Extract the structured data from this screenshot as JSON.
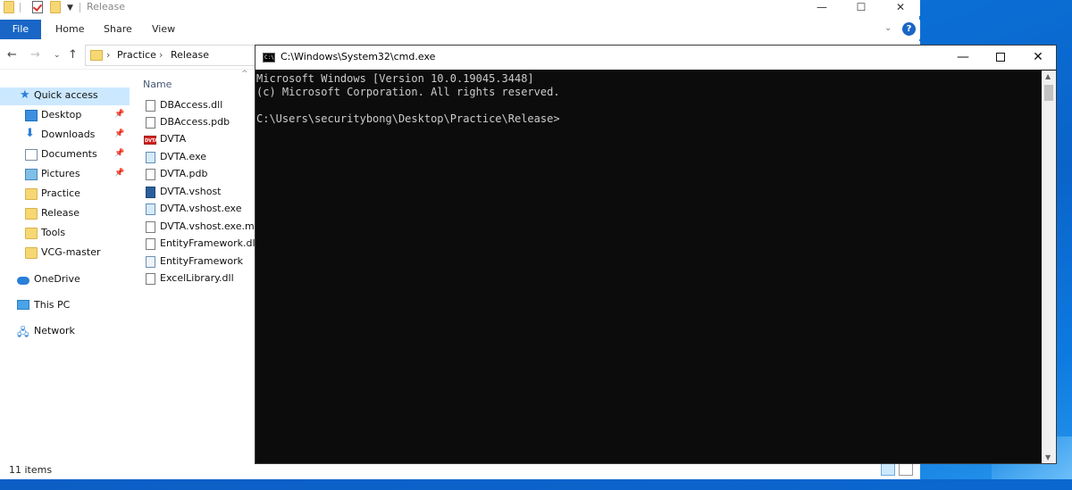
{
  "explorer": {
    "window_title": "Release",
    "ribbon_tabs": {
      "file": "File",
      "home": "Home",
      "share": "Share",
      "view": "View"
    },
    "breadcrumb": [
      "Practice",
      "Release"
    ],
    "nav_header": "Name",
    "nav": {
      "quick_access": "Quick access",
      "pinned": [
        "Desktop",
        "Downloads",
        "Documents",
        "Pictures"
      ],
      "folders": [
        "Practice",
        "Release",
        "Tools",
        "VCG-master"
      ],
      "onedrive": "OneDrive",
      "this_pc": "This PC",
      "network": "Network"
    },
    "files": [
      {
        "name": "DBAccess.dll",
        "icon": "dll-file-icon"
      },
      {
        "name": "DBAccess.pdb",
        "icon": "pdb-file-icon"
      },
      {
        "name": "DVTA",
        "icon": "dvta-app-icon"
      },
      {
        "name": "DVTA.exe",
        "icon": "exe-file-icon"
      },
      {
        "name": "DVTA.pdb",
        "icon": "pdb-file-icon"
      },
      {
        "name": "DVTA.vshost",
        "icon": "vshost-app-icon"
      },
      {
        "name": "DVTA.vshost.exe",
        "icon": "exe-file-icon"
      },
      {
        "name": "DVTA.vshost.exe.mani",
        "icon": "manifest-file-icon"
      },
      {
        "name": "EntityFramework.dll",
        "icon": "dll-file-icon"
      },
      {
        "name": "EntityFramework",
        "icon": "xml-file-icon"
      },
      {
        "name": "ExcelLibrary.dll",
        "icon": "dll-file-icon"
      }
    ],
    "status": "11 items"
  },
  "cmd": {
    "title": "C:\\Windows\\System32\\cmd.exe",
    "icon_text": "C:\\.",
    "lines": [
      "Microsoft Windows [Version 10.0.19045.3448]",
      "(c) Microsoft Corporation. All rights reserved.",
      "",
      "C:\\Users\\securitybong\\Desktop\\Practice\\Release>"
    ]
  },
  "colors": {
    "file_tab": "#1966c6",
    "selection": "#cce8ff",
    "console_bg": "#0c0c0c",
    "console_text": "#cccccc",
    "desktop": "#0a63c9"
  }
}
